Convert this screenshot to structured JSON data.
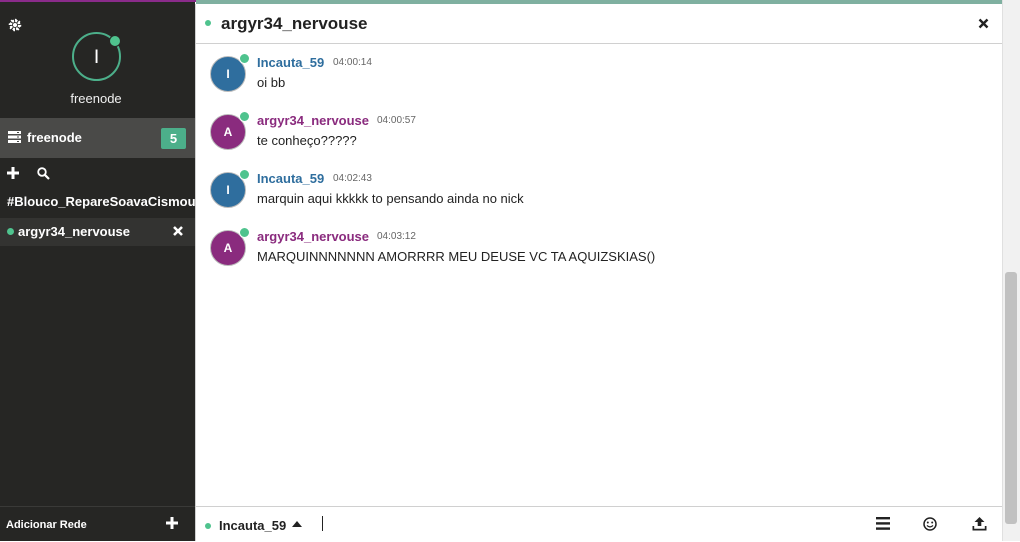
{
  "sidebar": {
    "network_name": "freenode",
    "avatar_letter": "I",
    "network_row": {
      "label": "freenode",
      "badge": "5"
    },
    "channel": "#Blouco_RepareSoavaCismou",
    "query": "argyr34_nervouse",
    "add_network": "Adicionar Rede"
  },
  "header": {
    "title": "argyr34_nervouse"
  },
  "messages": [
    {
      "avatar": "I",
      "nick": "Incauta_59",
      "time": "04:00:14",
      "text": "oi bb"
    },
    {
      "avatar": "A",
      "nick": "argyr34_nervouse",
      "time": "04:00:57",
      "text": "te conheço?????"
    },
    {
      "avatar": "I",
      "nick": "Incauta_59",
      "time": "04:02:43",
      "text": "marquin aqui kkkkk to pensando ainda no nick"
    },
    {
      "avatar": "A",
      "nick": "argyr34_nervouse",
      "time": "04:03:12",
      "text": "MARQUINNNNNNN AMORRRR MEU DEUSE VC TA AQUIZSKIAS()"
    }
  ],
  "footer": {
    "nick": "Incauta_59"
  },
  "colors": {
    "accent_green": "#4fc38e",
    "nick_blue": "#2f6e9e",
    "nick_purple": "#8a2b7e",
    "sidebar_bg": "#262624"
  }
}
